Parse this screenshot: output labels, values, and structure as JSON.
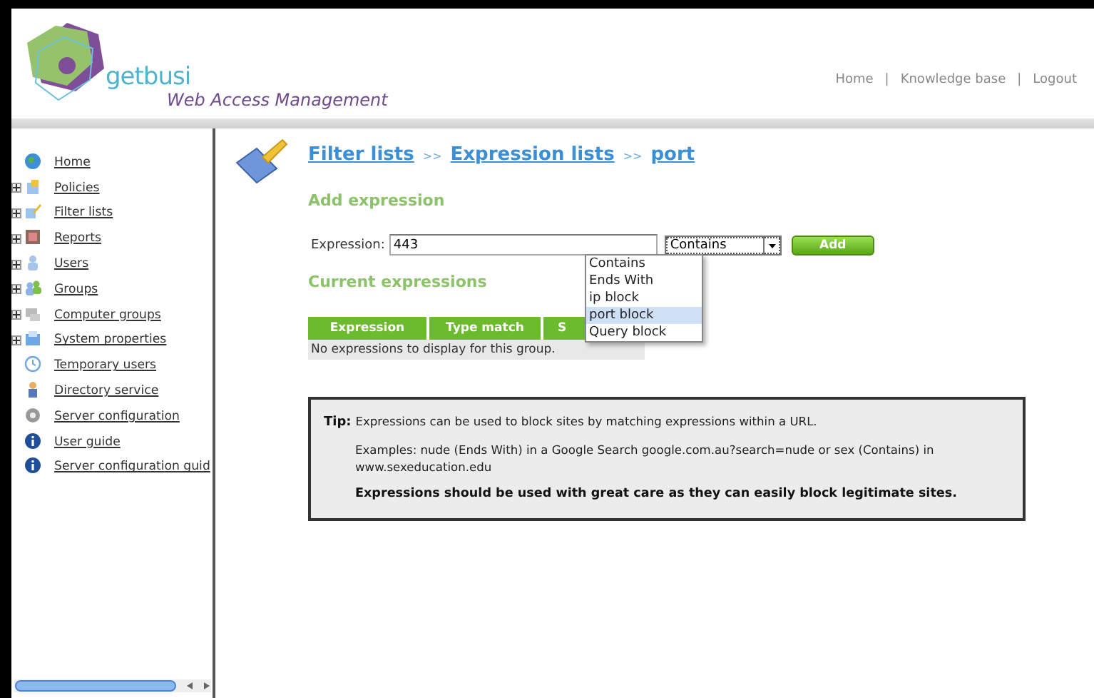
{
  "header": {
    "brand": "getbusi",
    "product": "Web Access Management",
    "links": [
      "Home",
      "Knowledge base",
      "Logout"
    ],
    "separator": "|"
  },
  "sidebar": {
    "items": [
      {
        "label": "Home",
        "expandable": false
      },
      {
        "label": "Policies",
        "expandable": true
      },
      {
        "label": "Filter lists",
        "expandable": true
      },
      {
        "label": "Reports",
        "expandable": true
      },
      {
        "label": "Users",
        "expandable": true
      },
      {
        "label": "Groups",
        "expandable": true
      },
      {
        "label": "Computer groups",
        "expandable": true
      },
      {
        "label": "System properties",
        "expandable": true
      },
      {
        "label": "Temporary users",
        "expandable": false
      },
      {
        "label": "Directory service",
        "expandable": false
      },
      {
        "label": "Server configuration",
        "expandable": false
      },
      {
        "label": "User guide",
        "expandable": false
      },
      {
        "label": "Server configuration guid",
        "expandable": false
      }
    ]
  },
  "breadcrumb": {
    "items": [
      "Filter lists",
      "Expression lists",
      "port"
    ],
    "separator": ">>"
  },
  "add_section": {
    "title": "Add expression",
    "field_label": "Expression:",
    "value": "443",
    "match_type": "Contains",
    "button": "Add",
    "options": [
      {
        "label": "Contains",
        "selected": false
      },
      {
        "label": "Ends With",
        "selected": false
      },
      {
        "label": "ip block",
        "selected": false
      },
      {
        "label": "port block",
        "selected": true
      },
      {
        "label": "Query block",
        "selected": false
      }
    ]
  },
  "current_section": {
    "title": "Current expressions",
    "columns": [
      "Expression",
      "Type match",
      "S"
    ],
    "empty_message": "No expressions to display for this group."
  },
  "tip": {
    "label": "Tip:",
    "text": "Expressions can be used to block sites by matching expressions within a URL.",
    "examples": "Examples: nude (Ends With) in a Google Search google.com.au?search=nude or sex (Contains) in www.sexeducation.edu",
    "warning": "Expressions should be used with great care as they can easily block legitimate sites."
  }
}
